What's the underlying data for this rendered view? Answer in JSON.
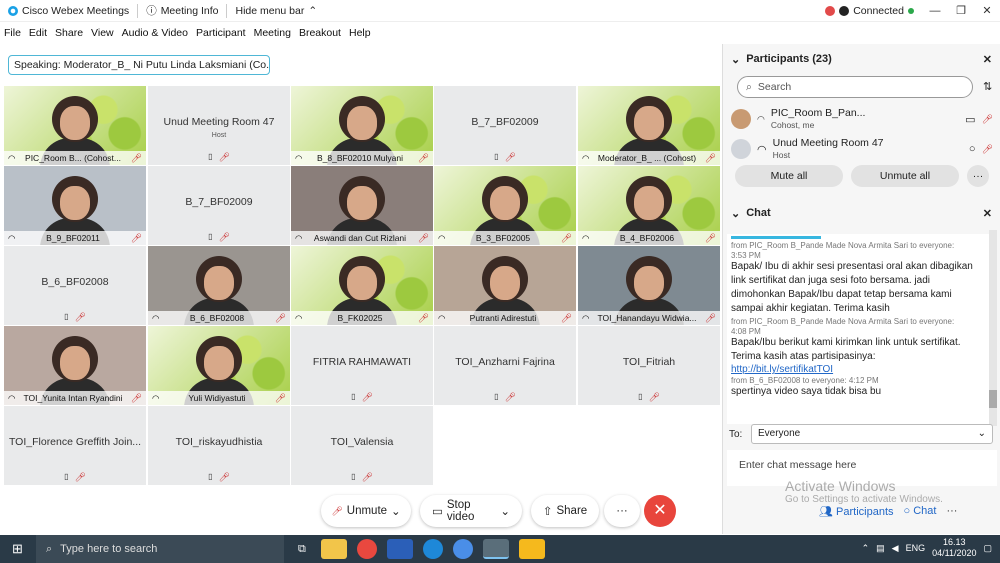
{
  "titlebar": {
    "app": "Cisco Webex Meetings",
    "meeting_info": "Meeting Info",
    "hide_menu": "Hide menu bar",
    "connection": "Connected"
  },
  "menu": [
    "File",
    "Edit",
    "Share",
    "View",
    "Audio & Video",
    "Participant",
    "Meeting",
    "Breakout",
    "Help"
  ],
  "speaking": "Speaking: Moderator_B_ Ni Putu Linda Laksmiani (Co...",
  "tiles": [
    {
      "name": "PIC_Room B... (Cohost...",
      "video": true
    },
    {
      "name": "Unud Meeting Room 47",
      "host": "Host",
      "video": false
    },
    {
      "name": "B_8_BF02010 Mulyani",
      "video": true
    },
    {
      "name": "B_7_BF02009",
      "video": false
    },
    {
      "name": "Moderator_B_ ... (Cohost)",
      "video": true
    },
    {
      "name": "B_9_BF02011",
      "video": true
    },
    {
      "name": "B_7_BF02009",
      "video": false
    },
    {
      "name": "Aswandi dan Cut Rizlani",
      "video": true
    },
    {
      "name": "B_3_BF02005",
      "video": true
    },
    {
      "name": "B_4_BF02006",
      "video": true
    },
    {
      "name": "B_6_BF02008",
      "video": false
    },
    {
      "name": "B_6_BF02008",
      "video": true
    },
    {
      "name": "B_FK02025",
      "video": true
    },
    {
      "name": "Putranti Adirestuti",
      "video": true
    },
    {
      "name": "TOI_Hanandayu Widwia...",
      "video": true
    },
    {
      "name": "TOI_Yunita Intan Ryandini",
      "video": true
    },
    {
      "name": "Yuli Widiyastuti",
      "video": true
    },
    {
      "name": "FITRIA RAHMAWATI",
      "video": false
    },
    {
      "name": "TOI_Anzharni Fajrina",
      "video": false
    },
    {
      "name": "TOI_Fitriah",
      "video": false
    },
    {
      "name": "TOI_Florence Greffith Join...",
      "video": false
    },
    {
      "name": "TOI_riskayudhistia",
      "video": false
    },
    {
      "name": "TOI_Valensia",
      "video": false
    }
  ],
  "controls": {
    "unmute": "Unmute",
    "stop_video": "Stop video",
    "share": "Share",
    "more": "···",
    "leave": "✕"
  },
  "participants": {
    "title": "Participants (23)",
    "search_placeholder": "Search",
    "rows": [
      {
        "name": "PIC_Room B_Pan...",
        "role": "Cohost, me"
      },
      {
        "name": "Unud Meeting Room 47",
        "role": "Host"
      }
    ],
    "mute_all": "Mute all",
    "unmute_all": "Unmute all"
  },
  "chat": {
    "title": "Chat",
    "messages": [
      {
        "meta": "from PIC_Room B_Pande Made Nova Armita Sari to everyone:",
        "time": "3:53 PM",
        "text": "Bapak/ Ibu di akhir sesi presentasi oral akan dibagikan link sertifikat dan juga sesi foto bersama. jadi dimohonkan Bapak/Ibu dapat tetap bersama kami sampai akhir kegiatan. Terima kasih"
      },
      {
        "meta": "from PIC_Room B_Pande Made Nova Armita Sari to everyone:",
        "time": "4:08 PM",
        "text": "Bapak/Ibu berikut kami kirimkan link untuk sertifikat. Terima kasih atas partisipasinya:",
        "link": "http://bit.ly/sertifikatTOI"
      },
      {
        "meta": "from B_6_BF02008 to everyone:",
        "time": "4:12 PM",
        "text": "spertinya video saya tidak bisa bu"
      }
    ],
    "to_label": "To:",
    "to_value": "Everyone",
    "input_placeholder": "Enter chat message here"
  },
  "watermark": {
    "line1": "Activate Windows",
    "line2": "Go to Settings to activate Windows."
  },
  "panel_tabs": {
    "participants": "Participants",
    "chat": "Chat"
  },
  "taskbar": {
    "search": "Type here to search",
    "lang": "ENG",
    "time": "16.13",
    "date": "04/11/2020"
  }
}
